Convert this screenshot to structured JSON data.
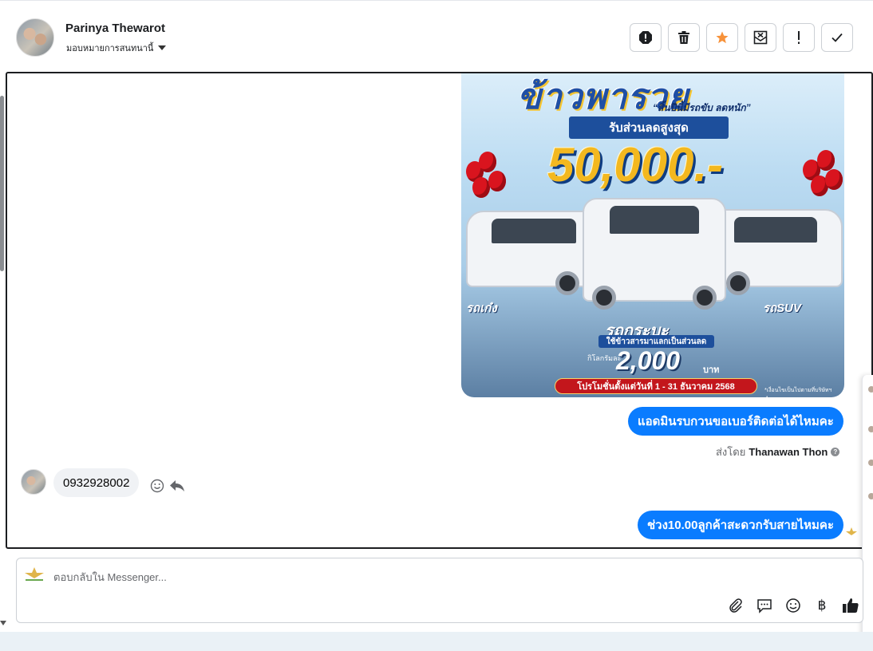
{
  "header": {
    "contact_name": "Parinya Thewarot",
    "assign_label": "มอบหมายการสนทนานี้",
    "actions": [
      {
        "name": "spam-button",
        "icon": "alert-octagon-icon"
      },
      {
        "name": "delete-button",
        "icon": "trash-icon"
      },
      {
        "name": "star-button",
        "icon": "star-icon",
        "color": "#f7923a"
      },
      {
        "name": "mark-unread-button",
        "icon": "envelope-x-icon"
      },
      {
        "name": "follow-up-button",
        "icon": "exclamation-icon"
      },
      {
        "name": "done-button",
        "icon": "check-icon"
      }
    ]
  },
  "promo_image": {
    "headline": "ข้าวพารวย",
    "tagline": "“สิ้นปีนี้มีรถขับ ลดหนัก”",
    "discount_label": "รับส่วนลดสูงสุด",
    "discount_amount": "50,000.-",
    "car_label_sedan": "รถเก๋ง",
    "car_label_pickup": "รถกระบะ",
    "car_label_suv": "รถSUV",
    "trade_label": "ใช้ข้าวสารมาแลกเป็นส่วนลด",
    "per_kg_label": "กิโลกรัมละ",
    "per_kg_amount": "2,000",
    "baht": "บาท",
    "promo_period": "โปรโมชั่นตั้งแต่วันที่ 1 - 31 ธันวาคม 2568",
    "fine_print": "*เงื่อนไขเป็นไปตามที่บริษัทฯ กำหนด"
  },
  "messages": {
    "outgoing_1": "แอดมินรบกวนขอเบอร์ติดต่อได้ไหมคะ",
    "sent_by_prefix": "ส่งโดย",
    "sent_by_name": "Thanawan Thon",
    "incoming_1": "0932928002",
    "outgoing_2": "ช่วง10.00ลูกค้าสะดวกรับสายไหมคะ"
  },
  "composer": {
    "placeholder": "ตอบกลับใน Messenger...",
    "icons": [
      "paperclip-icon",
      "chat-bubble-icon",
      "emoji-icon",
      "baht-icon",
      "thumbs-up-icon"
    ],
    "baht_glyph": "฿"
  },
  "colors": {
    "accent_blue": "#0a7cff",
    "incoming_bg": "#f0f2f5",
    "star_orange": "#f7923a"
  }
}
